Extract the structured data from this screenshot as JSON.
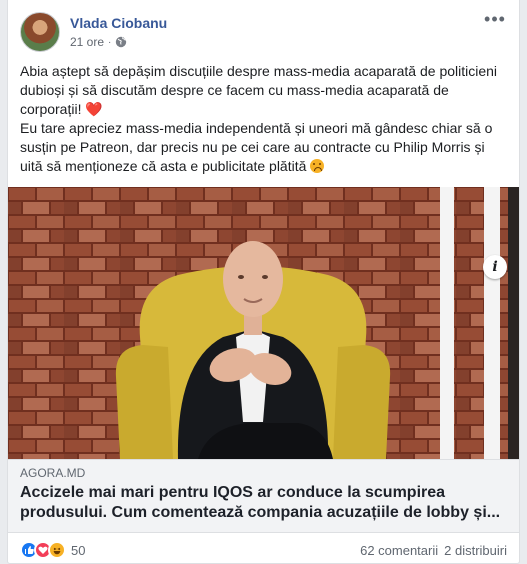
{
  "post": {
    "author": "Vlada Ciobanu",
    "time": "21 ore",
    "text_p1": "Abia aștept să depășim discuțiile despre mass-media acaparată de politicieni dubioși și să discutăm despre ce facem cu mass-media acaparată de corporații!",
    "text_p2": "Eu tare apreciez mass-media independentă și uneori mă gândesc chiar să o susțin pe Patreon, dar precis nu pe cei care au contracte cu Philip Morris și uită să menționeze că asta e publicitate plătită",
    "heart_emoji": "❤️"
  },
  "link": {
    "domain": "AGORA.MD",
    "title": "Accizele mai mari pentru IQOS ar conduce la scumpirea produsului. Cum comentează compania acuzațiile de lobby și..."
  },
  "footer": {
    "reaction_count": "50",
    "comments": "62 comentarii",
    "shares": "2 distribuiri"
  },
  "icons": {
    "more": "more-options-icon",
    "globe": "globe-icon",
    "info": "info-icon"
  }
}
